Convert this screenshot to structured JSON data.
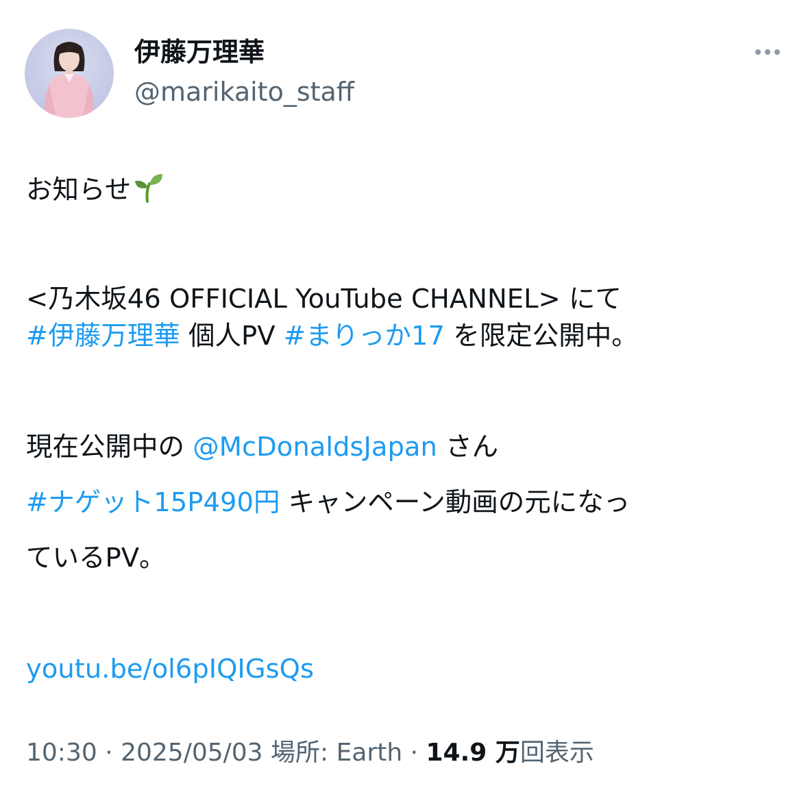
{
  "user": {
    "display_name": "伊藤万理華",
    "handle": "@marikaito_staff"
  },
  "tweet": {
    "line1": "お知らせ",
    "line1_emoji": "seedling-emoji",
    "line2": "<乃木坂46 OFFICIAL YouTube CHANNEL> にて",
    "line3_tag1": "#伊藤万理華",
    "line3_mid": " 個人PV ",
    "line3_tag2": "#まりっか17",
    "line3_end": " を限定公開中。",
    "line4_start": "現在公開中の ",
    "line4_mention": "@McDonaldsJapan",
    "line4_end": " さん",
    "line5_tag": "#ナゲット15P490円",
    "line5_end": " キャンペーン動画の元になっ",
    "line6": "ているPV。",
    "link": "youtu.be/ol6pIQIGsQs"
  },
  "meta": {
    "time": "10:30",
    "sep1": " · ",
    "date": "2025/05/03",
    "location": " 場所: Earth",
    "sep2": " · ",
    "views_number": "14.9 万",
    "views_label": "回表示"
  },
  "colors": {
    "link": "#1d9bf0",
    "text": "#0f1419",
    "secondary": "#536471"
  },
  "icons": {
    "more": "more-horizontal-icon",
    "emoji": "seedling-emoji"
  }
}
